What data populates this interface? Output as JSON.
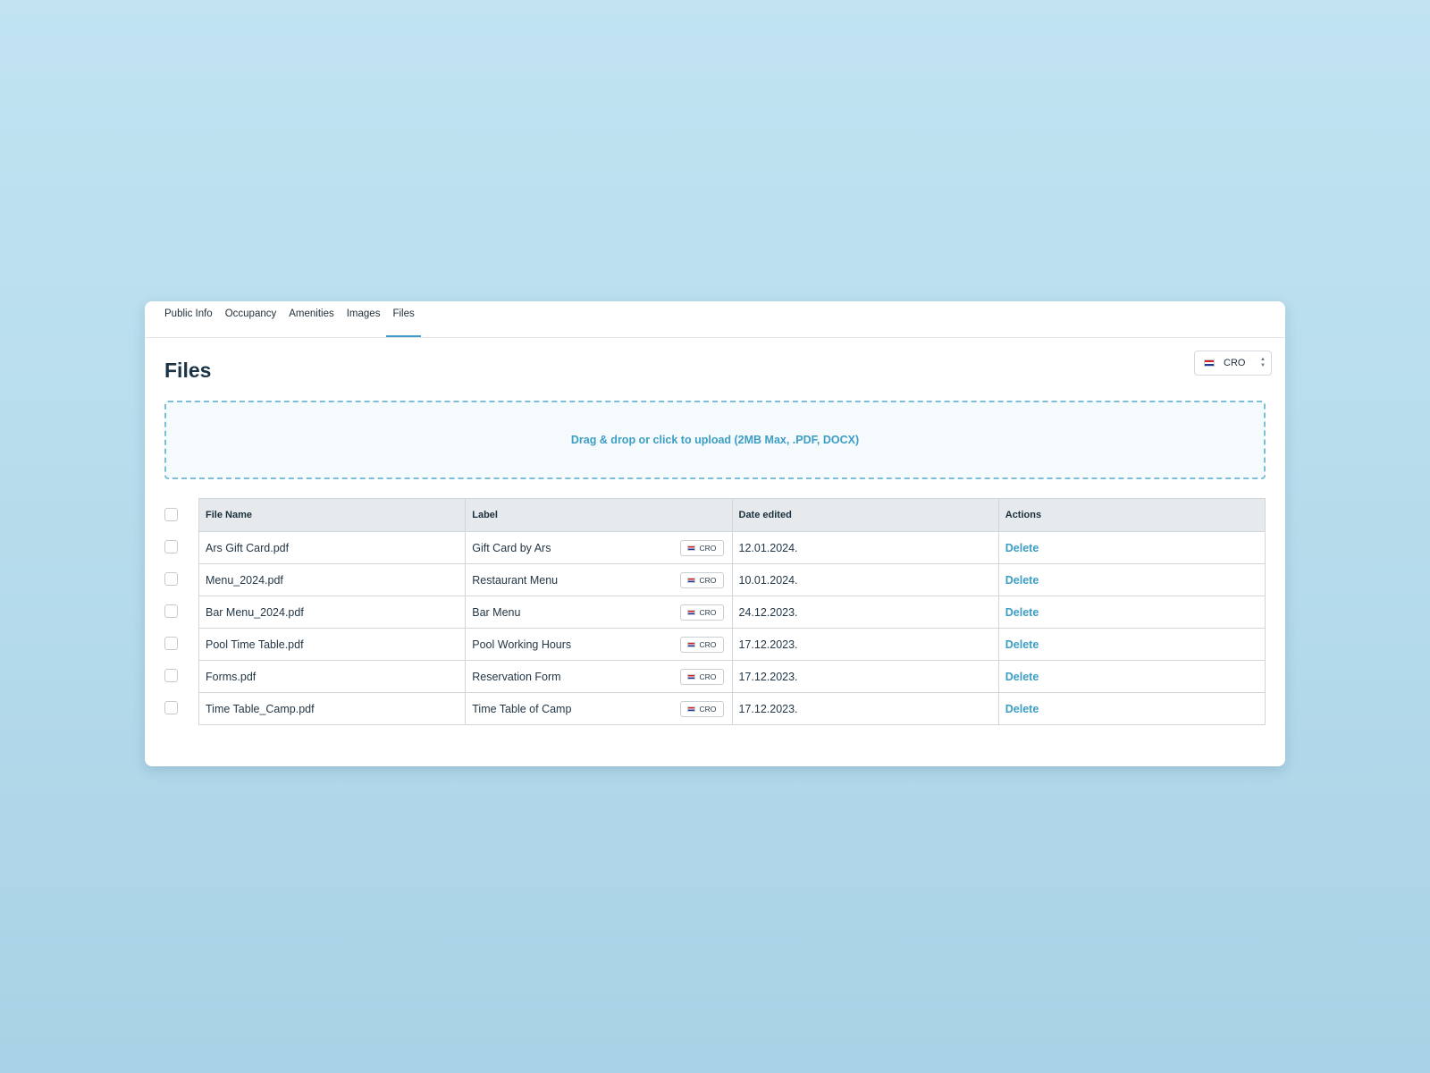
{
  "tabs": [
    {
      "label": "Public Info"
    },
    {
      "label": "Occupancy"
    },
    {
      "label": "Amenities"
    },
    {
      "label": "Images"
    },
    {
      "label": "Files",
      "active": true
    }
  ],
  "page_title": "Files",
  "language_selector": {
    "value": "CRO",
    "flag_icon": "croatian-flag-icon"
  },
  "upload": {
    "text": "Drag & drop or click to upload (2MB Max, .PDF, DOCX)"
  },
  "table": {
    "columns": [
      "File Name",
      "Label",
      "Date edited",
      "Actions"
    ],
    "rows": [
      {
        "file_name": "Ars Gift Card.pdf",
        "label": "Gift Card by Ars",
        "lang": "CRO",
        "date": "12.01.2024.",
        "action": "Delete"
      },
      {
        "file_name": "Menu_2024.pdf",
        "label": "Restaurant Menu",
        "lang": "CRO",
        "date": "10.01.2024.",
        "action": "Delete"
      },
      {
        "file_name": "Bar Menu_2024.pdf",
        "label": "Bar Menu",
        "lang": "CRO",
        "date": "24.12.2023.",
        "action": "Delete"
      },
      {
        "file_name": "Pool Time Table.pdf",
        "label": "Pool Working Hours",
        "lang": "CRO",
        "date": "17.12.2023.",
        "action": "Delete"
      },
      {
        "file_name": "Forms.pdf",
        "label": "Reservation Form",
        "lang": "CRO",
        "date": "17.12.2023.",
        "action": "Delete"
      },
      {
        "file_name": "Time Table_Camp.pdf",
        "label": "Time Table of Camp",
        "lang": "CRO",
        "date": "17.12.2023.",
        "action": "Delete"
      }
    ]
  },
  "colors": {
    "accent": "#3c9ec4",
    "title": "#1a3346",
    "header_bg": "#e6eaec"
  }
}
